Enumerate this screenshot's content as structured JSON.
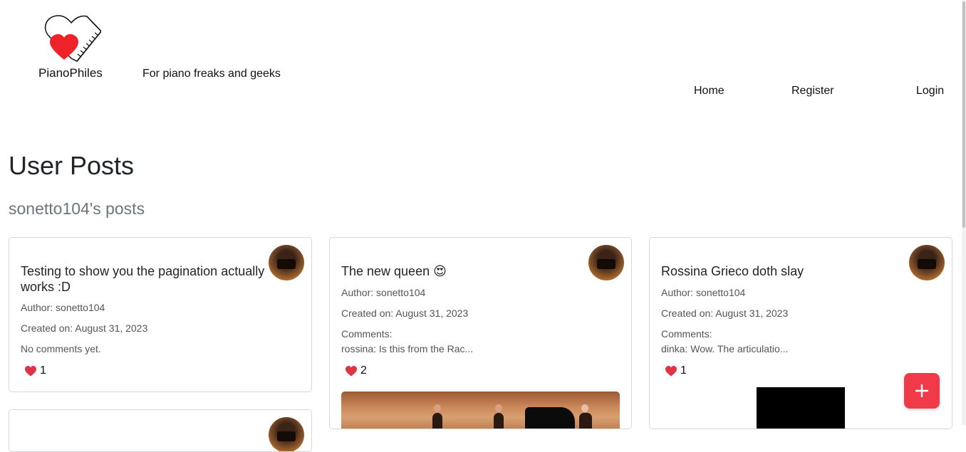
{
  "header": {
    "brand": "PianoPhiles",
    "tagline": "For piano freaks and geeks",
    "nav": [
      "Home",
      "Register",
      "Login"
    ]
  },
  "page": {
    "title": "User Posts",
    "subtitle": "sonetto104's posts"
  },
  "posts": [
    {
      "title": "Testing to show you the pagination actually works :D",
      "author": "Author: sonetto104",
      "created": "Created on: August 31, 2023",
      "comments_label": "No comments yet.",
      "comment_preview": "",
      "likes": "1"
    },
    {
      "title": "The new queen 😍",
      "author": "Author: sonetto104",
      "created": "Created on: August 31, 2023",
      "comments_label": "Comments:",
      "comment_preview": "rossina: Is this from the Rac...",
      "likes": "2"
    },
    {
      "title": "Rossina Grieco doth slay",
      "author": "Author: sonetto104",
      "created": "Created on: August 31, 2023",
      "comments_label": "Comments:",
      "comment_preview": "dinka: Wow. The articulatio...",
      "likes": "1"
    }
  ],
  "colors": {
    "heart": "#dc3545",
    "fab": "#f03a4a",
    "muted": "#6c757d"
  },
  "icons": {
    "logo": "heart-piano-logo",
    "like": "heart-icon",
    "fab": "plus-icon"
  }
}
